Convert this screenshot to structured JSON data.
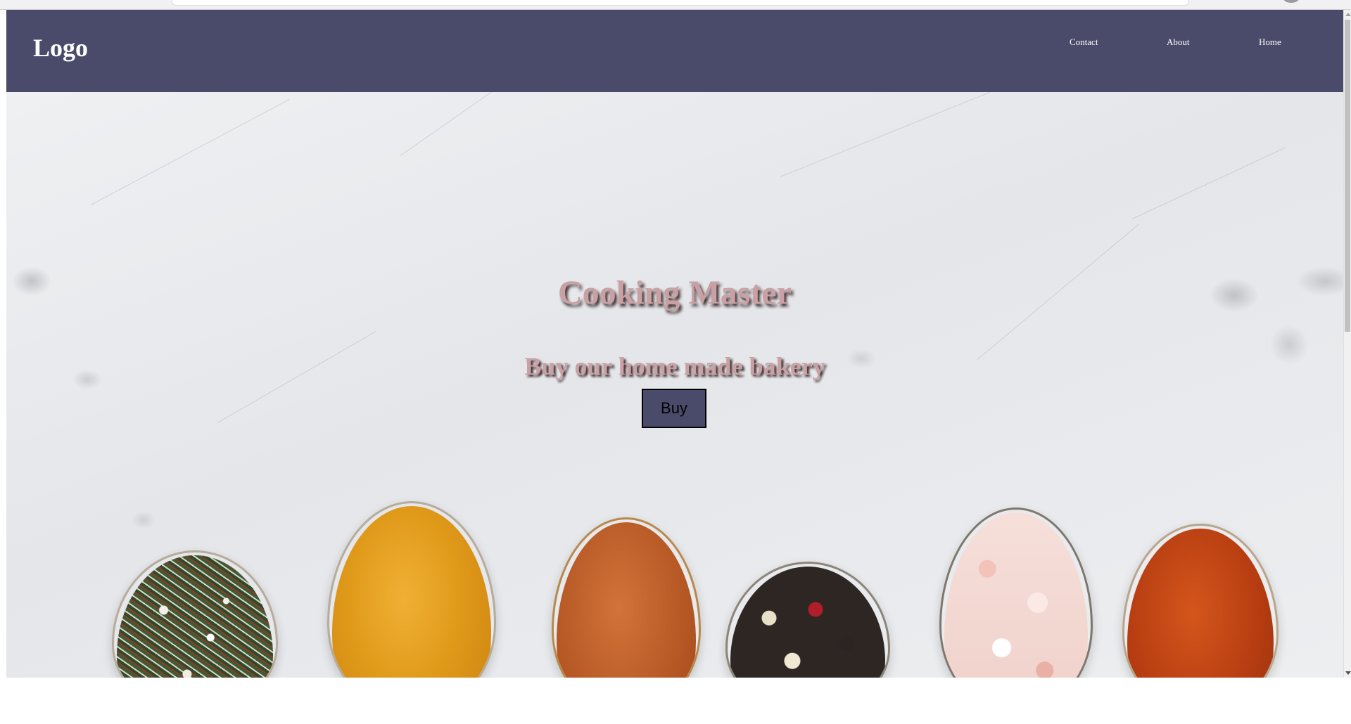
{
  "navbar": {
    "logo": "Logo",
    "links": [
      {
        "label": "Contact"
      },
      {
        "label": "About"
      },
      {
        "label": "Home"
      }
    ],
    "background_color": "#4a4b6a"
  },
  "hero": {
    "title": "Cooking Master",
    "subtitle": "Buy our home made bakery",
    "button_label": "Buy",
    "text_color": "#c9a0a4",
    "button_color": "#4a4b6a",
    "background_image": "marble-spices-spoons"
  }
}
